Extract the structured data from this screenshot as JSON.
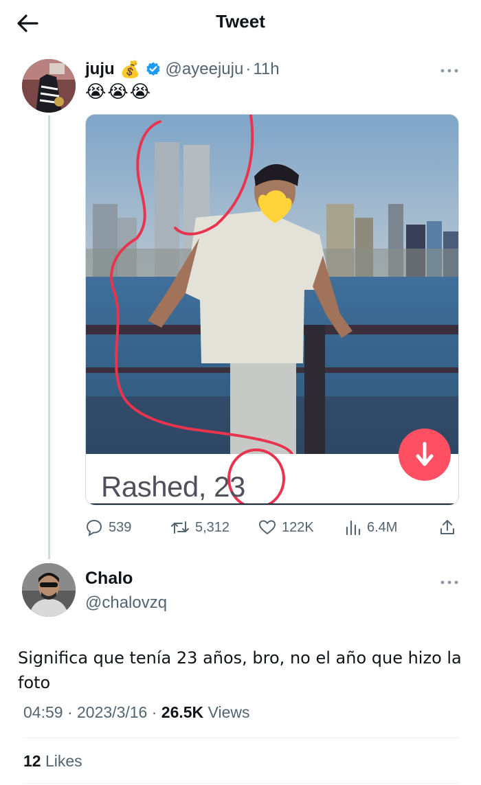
{
  "header": {
    "title": "Tweet"
  },
  "tweet": {
    "author_name": "juju",
    "author_emoji": "💰",
    "handle": "@ayeejuju",
    "separator": "·",
    "time": "11h",
    "text": "😭😭😭",
    "media": {
      "card_text": "Rashed, 23"
    },
    "stats": {
      "replies": "539",
      "retweets": "5,312",
      "likes": "122K",
      "views": "6.4M"
    }
  },
  "reply": {
    "author_name": "Chalo",
    "handle": "@chalovzq",
    "text": "Significa que tenía 23 años, bro, no el año que hizo la foto",
    "time": "04:59",
    "date": "2023/3/16",
    "separator": "·",
    "views_count": "26.5K",
    "views_label": "Views",
    "likes_count": "12",
    "likes_label": "Likes"
  },
  "colors": {
    "accent": "#1d9bf0",
    "muted": "#536471",
    "card_button": "#ff4f62",
    "annotation": "#e8344f"
  }
}
